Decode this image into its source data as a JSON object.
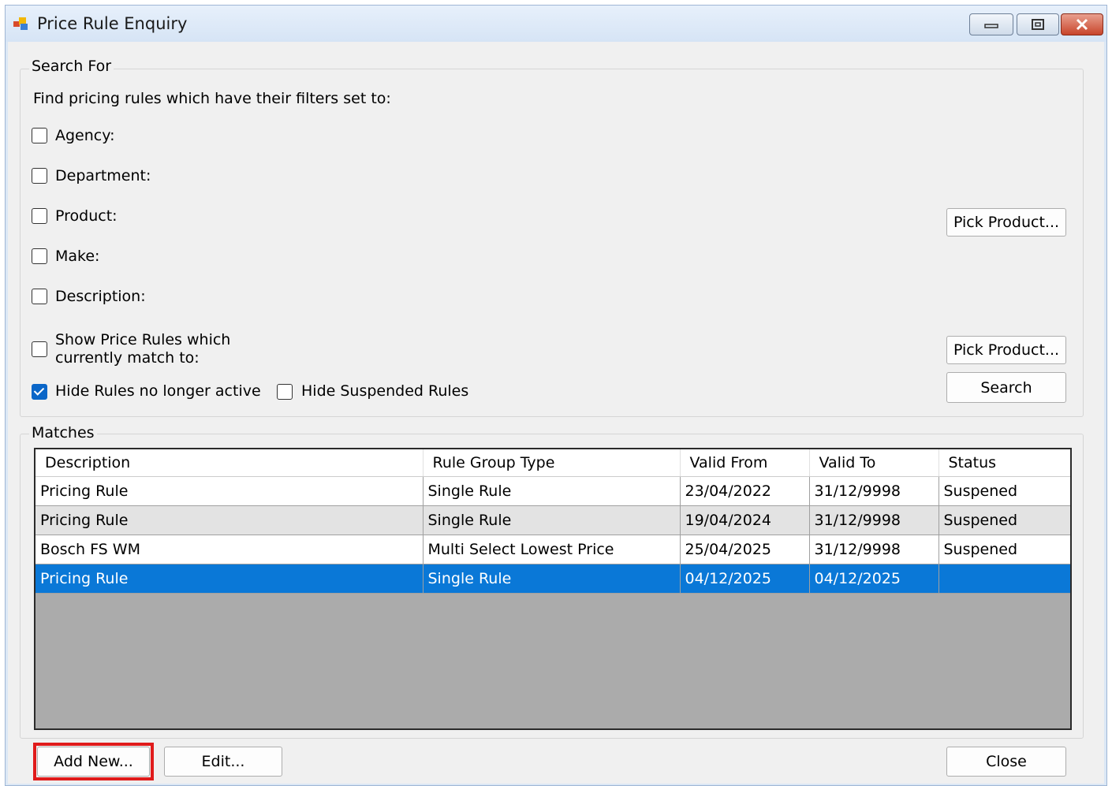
{
  "window": {
    "title": "Price Rule Enquiry"
  },
  "search_group": {
    "label": "Search For",
    "instruction": "Find pricing rules which have their filters set to:",
    "filters": [
      {
        "label": "Agency:",
        "checked": false
      },
      {
        "label": "Department:",
        "checked": false
      },
      {
        "label": "Product:",
        "checked": false
      },
      {
        "label": "Make:",
        "checked": false
      },
      {
        "label": "Description:",
        "checked": false
      }
    ],
    "show_match": {
      "label_line1": "Show Price Rules which",
      "label_line2": "currently match to:",
      "checked": false
    },
    "hide_inactive": {
      "label": "Hide Rules no longer active",
      "checked": true
    },
    "hide_suspended": {
      "label": "Hide Suspended Rules",
      "checked": false
    },
    "pick_product_label": "Pick Product...",
    "pick_product_label_2": "Pick Product...",
    "search_label": "Search"
  },
  "matches_group": {
    "label": "Matches",
    "columns": [
      "Description",
      "Rule Group Type",
      "Valid From",
      "Valid To",
      "Status"
    ],
    "rows": [
      [
        "Pricing Rule",
        "Single Rule",
        "23/04/2022",
        "31/12/9998",
        "Suspened"
      ],
      [
        "Pricing Rule",
        "Single Rule",
        "19/04/2024",
        "31/12/9998",
        "Suspened"
      ],
      [
        "Bosch FS WM",
        "Multi Select Lowest Price",
        "25/04/2025",
        "31/12/9998",
        "Suspened"
      ],
      [
        "Pricing Rule",
        "Single Rule",
        "04/12/2025",
        "04/12/2025",
        ""
      ]
    ]
  },
  "footer": {
    "add_new_label": "Add New...",
    "edit_label": "Edit...",
    "close_label": "Close"
  },
  "colors": {
    "selection": "#0a78d7",
    "checkbox_checked": "#0a66c8",
    "highlight": "#e01b1b"
  }
}
